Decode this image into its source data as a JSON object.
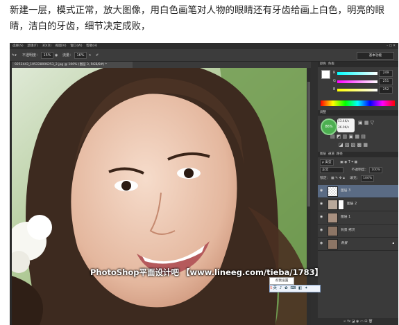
{
  "article": {
    "caption_line1": "新建一层，模式正常，放大图像，用白色画笔对人物的眼睛还有牙齿给画上白色，明亮的眼",
    "caption_line2": "睛，洁白的牙齿，细节决定成败，"
  },
  "menubar": {
    "items": [
      "选择(S)",
      "滤镜(T)",
      "3D(D)",
      "视图(V)",
      "窗口(W)",
      "帮助(H)"
    ],
    "window_controls": "– ◻ ✕"
  },
  "options_bar": {
    "mode_label": "模式：",
    "opacity_label": "不透明度：",
    "opacity_value": "15%",
    "flow_label": "流量：",
    "flow_value": "16%",
    "workspace": "基本功能"
  },
  "document_tab": "9252443_105228006253_2.jpg @ 100% (图层 3, RGB/8#) *",
  "color_panel": {
    "tabs": [
      "颜色",
      "色板"
    ],
    "r": "249",
    "g": "251",
    "b": "252"
  },
  "adjust_panel": {
    "tab": "调整",
    "badge": "86%",
    "speed_up": "53.4K/s",
    "speed_down": "36.0K/s"
  },
  "layers_panel": {
    "tabs": [
      "图层",
      "通道",
      "路径"
    ],
    "filter": "ρ 类型",
    "blend_mode": "正常",
    "opacity_label": "不透明度：",
    "opacity_value": "100%",
    "lock_label": "锁定：",
    "fill_label": "填充：",
    "fill_value": "100%",
    "layers": [
      {
        "name": "图层 3",
        "selected": true
      },
      {
        "name": "图层 2",
        "selected": false
      },
      {
        "name": "图层 1",
        "selected": false
      },
      {
        "name": "背景 拷贝",
        "selected": false
      },
      {
        "name": "背景",
        "selected": false
      }
    ]
  },
  "ime": {
    "label": "点我设置"
  },
  "watermark": "PhotoShop平面设计吧 【www.lineeg.com/tieba/1783】",
  "colors": {
    "ps_bg": "#3a3a3a",
    "selected_layer": "#5a6b84"
  }
}
